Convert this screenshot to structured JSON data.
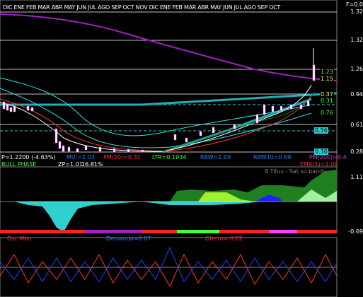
{
  "months": [
    "DIC",
    "ENE",
    "FEB",
    "MAR",
    "ABR",
    "MAY",
    "JUN",
    "JUL",
    "AGO",
    "SEP",
    "OCT",
    "NOV",
    "DIC",
    "ENE",
    "FEB",
    "MAR",
    "ABR",
    "MAY",
    "JUN",
    "JUL",
    "AGO",
    "SEP",
    "OCT"
  ],
  "month_strip": "DIC  ENE    FEB MAR ABR MAY JUN JUL    AGO SEP  OCT  NOV DIC  ENE    FEB MAR ABR MAY JUN JUL    AGO SEP  OCT",
  "right_axis": {
    "top": "F=0.0",
    "levels": [
      "1.32",
      "1.32",
      "1.26",
      "0.94",
      "0.61",
      "0.28"
    ],
    "lower_top": "1.11",
    "lower_bottom": "-0.69"
  },
  "price_tags": {
    "t1": "1.23",
    "t2": "1.15",
    "t3": "0.37",
    "t4": "0.31",
    "t5": "0.76",
    "t6": "0.56",
    "t7": "0.30"
  },
  "status_row1": {
    "price": "P=1.2200 (-4.63%)",
    "mu": "MU:=1.03",
    "pm": "PM(20)=0.31",
    "ltr": "LTR=0.1034",
    "rbw": "RBW=1.09",
    "rbw10": "RBW10=0.69",
    "pm200": "PM(200)=0.4"
  },
  "status_row2": {
    "phase": "BULL PHASE",
    "zp": "ZP=1.01",
    "pct": "16.81%",
    "ema": "EMA(1)=1.08"
  },
  "indicator_label": "8 Titus - Sat so bands",
  "lower_panel": {
    "left": "Osc Merc",
    "demand": "Demanda=0.07",
    "offer": "Oferta=-0.62"
  }
}
